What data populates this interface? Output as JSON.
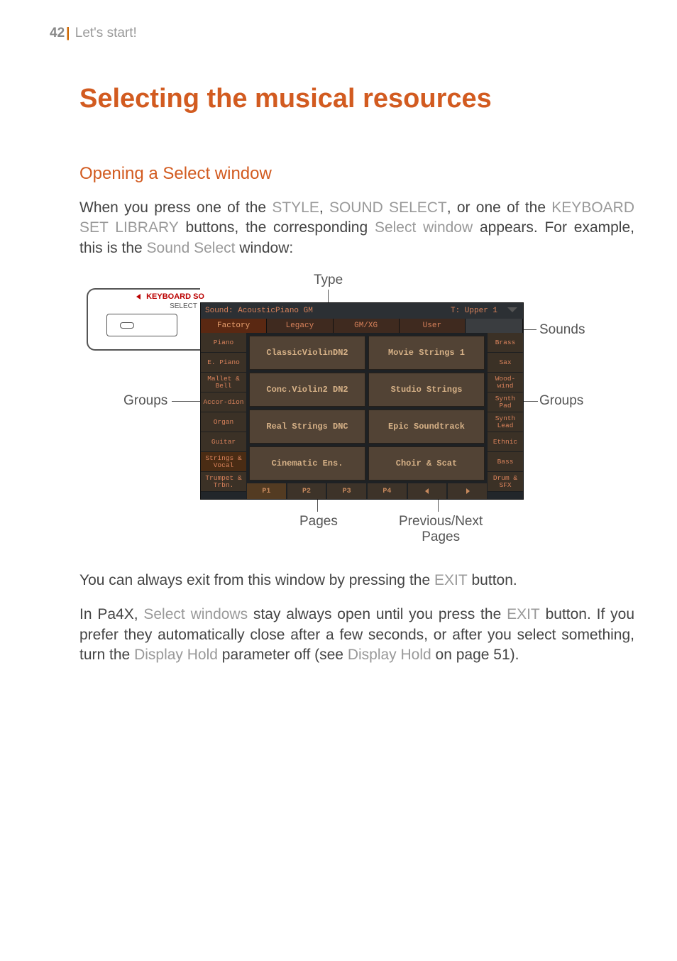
{
  "header": {
    "page_number": "42",
    "divider": "|",
    "section": "Let's start!"
  },
  "title": "Selecting the musical resources",
  "subtitle": "Opening a Select window",
  "para1": {
    "t1": "When you press one of the ",
    "k1": "STYLE",
    "t2": ", ",
    "k2": "SOUND SELECT",
    "t3": ", or one of the ",
    "k3": "KEYBOARD SET LIBRARY",
    "t4": " buttons, the corresponding ",
    "k4": "Select window",
    "t5": " appears. For example, this is the ",
    "k5": "Sound Select",
    "t6": " window:"
  },
  "figure": {
    "ann_type": "Type",
    "ann_groups_l": "Groups",
    "ann_groups_r": "Groups",
    "ann_sounds": "Sounds",
    "ann_pages": "Pages",
    "ann_prevnext_1": "Previous/Next",
    "ann_prevnext_2": "Pages",
    "hw_lbl1": "KEYBOARD SO",
    "hw_lbl2": "SELECT"
  },
  "screen": {
    "sound_label": "Sound: AcousticPiano GM",
    "track_label": "T: Upper 1",
    "type_tabs": [
      "Factory",
      "Legacy",
      "GM/XG",
      "User"
    ],
    "active_type_tab": 0,
    "groups_left": [
      "Piano",
      "E. Piano",
      "Mallet & Bell",
      "Accor-dion",
      "Organ",
      "Guitar",
      "Strings & Vocal",
      "Trumpet & Trbn."
    ],
    "groups_right": [
      "Brass",
      "Sax",
      "Wood-wind",
      "Synth Pad",
      "Synth Lead",
      "Ethnic",
      "Bass",
      "Drum & SFX"
    ],
    "sounds": [
      "ClassicViolinDN2",
      "Movie Strings 1",
      "Conc.Violin2 DN2",
      "Studio Strings",
      "Real Strings DNC",
      "Epic Soundtrack",
      "Cinematic Ens.",
      "Choir & Scat"
    ],
    "page_tabs": [
      "P1",
      "P2",
      "P3",
      "P4"
    ],
    "active_page_tab": 0
  },
  "para2": {
    "t1": "You can always exit from this window by pressing the ",
    "k1": "EXIT",
    "t2": " button."
  },
  "para3": {
    "t1": "In Pa4X, ",
    "k1": "Select windows",
    "t2": " stay always open until you press the ",
    "k2": "EXIT",
    "t3": " button. If you prefer they automatically close after a few seconds, or after you select something, turn the ",
    "k3": "Display Hold",
    "t4": " parameter off (see ",
    "k4": "Display Hold",
    "t5": " on page 51)."
  }
}
